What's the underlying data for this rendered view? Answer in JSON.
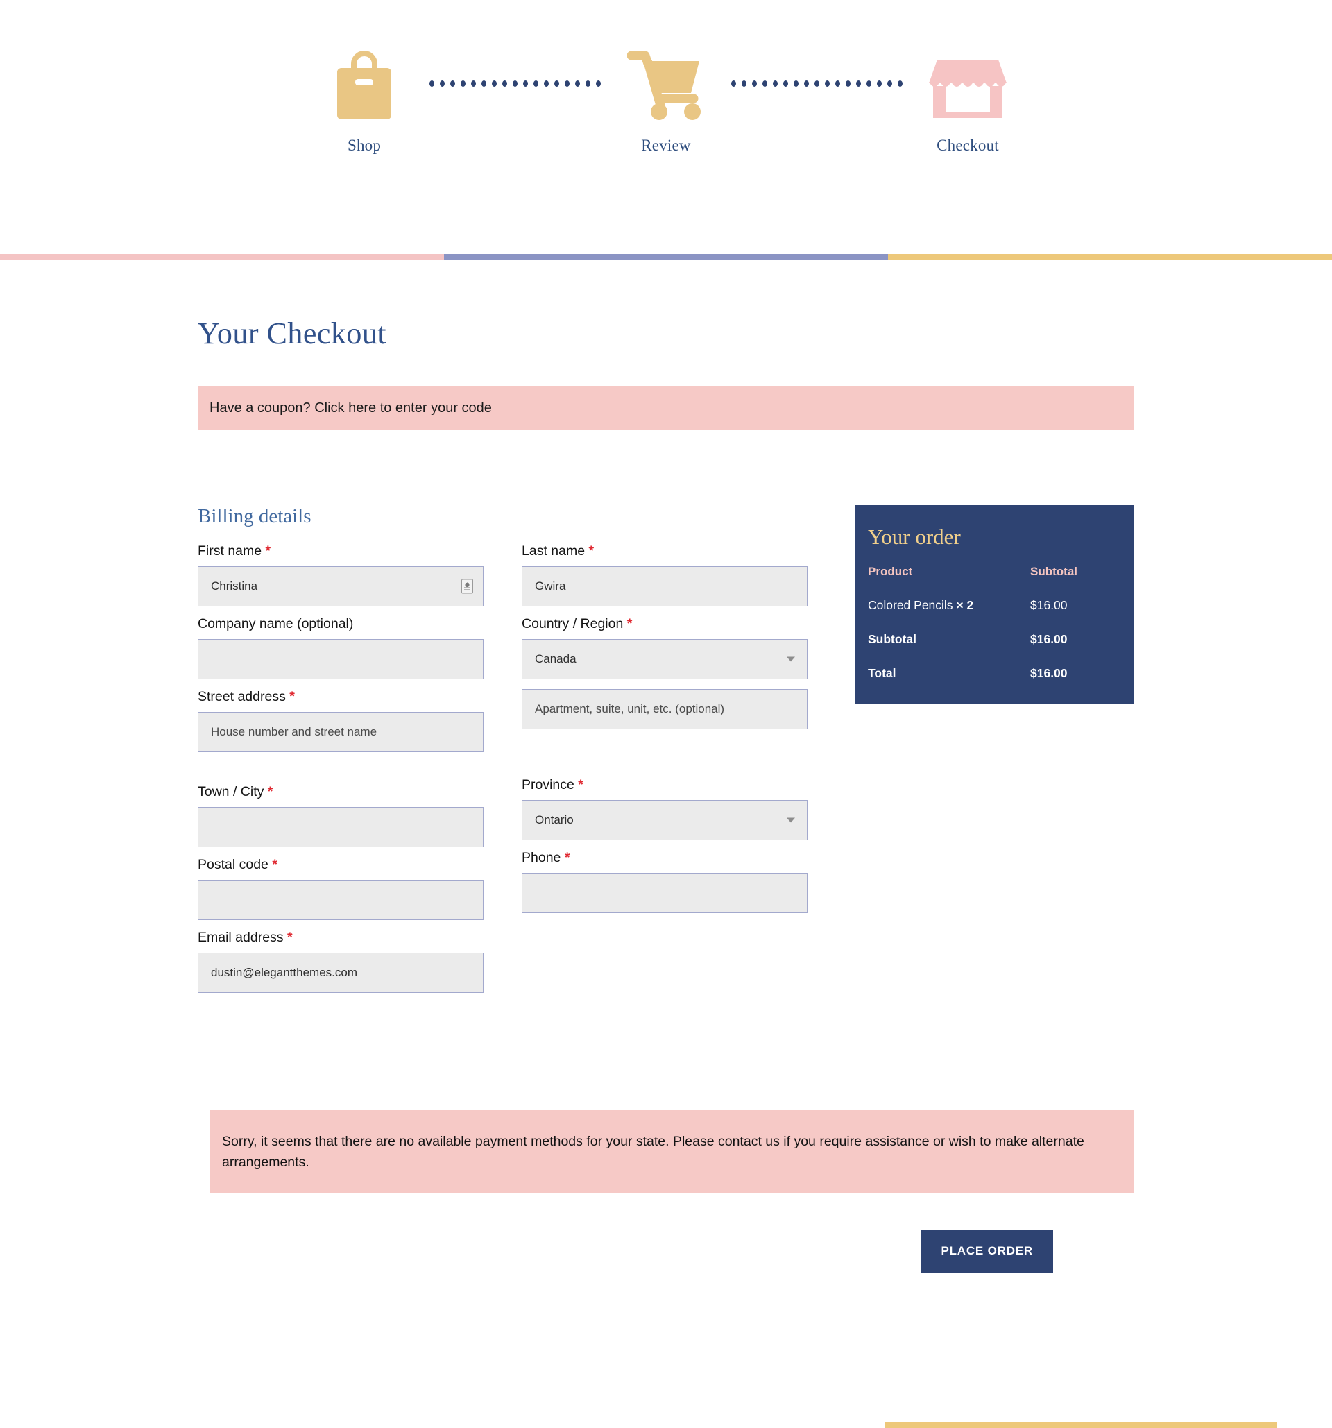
{
  "steps": {
    "items": [
      {
        "label": "Shop",
        "icon": "shopping-bag-icon",
        "color": "#e9c684"
      },
      {
        "label": "Review",
        "icon": "shopping-cart-icon",
        "color": "#e9c684"
      },
      {
        "label": "Checkout",
        "icon": "storefront-icon",
        "color": "#f6c4c4"
      }
    ],
    "connector_dot_color": "#2e4372"
  },
  "progress_bar": {
    "segments": [
      {
        "name": "pink",
        "color": "#f4c4c4"
      },
      {
        "name": "blue",
        "color": "#8b94c4"
      },
      {
        "name": "yellow",
        "color": "#edc87a"
      }
    ]
  },
  "page": {
    "title": "Your Checkout"
  },
  "coupon": {
    "text": "Have a coupon? Click here to enter your code"
  },
  "billing": {
    "heading": "Billing details",
    "required_mark": "*",
    "fields": {
      "first_name": {
        "label": "First name",
        "required": true,
        "value": "Christina",
        "placeholder": ""
      },
      "last_name": {
        "label": "Last name",
        "required": true,
        "value": "Gwira",
        "placeholder": ""
      },
      "company": {
        "label": "Company name (optional)",
        "required": false,
        "value": "",
        "placeholder": ""
      },
      "country": {
        "label": "Country / Region",
        "required": true,
        "value": "Canada",
        "placeholder": ""
      },
      "street_address": {
        "label": "Street address",
        "required": true,
        "value": "",
        "placeholder": "House number and street name"
      },
      "address_2": {
        "label": "",
        "required": false,
        "value": "",
        "placeholder": "Apartment, suite, unit, etc. (optional)"
      },
      "town_city": {
        "label": "Town / City",
        "required": true,
        "value": "",
        "placeholder": ""
      },
      "province": {
        "label": "Province",
        "required": true,
        "value": "Ontario",
        "placeholder": ""
      },
      "postal_code": {
        "label": "Postal code",
        "required": true,
        "value": "",
        "placeholder": ""
      },
      "phone": {
        "label": "Phone",
        "required": true,
        "value": "",
        "placeholder": ""
      },
      "email": {
        "label": "Email address",
        "required": true,
        "value": "dustin@elegantthemes.com",
        "placeholder": ""
      }
    }
  },
  "order": {
    "title": "Your order",
    "columns": {
      "product": "Product",
      "subtotal": "Subtotal"
    },
    "items": [
      {
        "name": "Colored Pencils",
        "quantity": "× 2",
        "subtotal": "$16.00"
      }
    ],
    "subtotal_label": "Subtotal",
    "subtotal_value": "$16.00",
    "total_label": "Total",
    "total_value": "$16.00",
    "background": "#2e4372",
    "title_color": "#f0cf8b",
    "header_color": "#f5c5c0"
  },
  "notice": {
    "message": "Sorry, it seems that there are no available payment methods for your state. Please contact us if you require assistance or wish to make alternate arrangements."
  },
  "actions": {
    "place_order": "PLACE ORDER"
  }
}
